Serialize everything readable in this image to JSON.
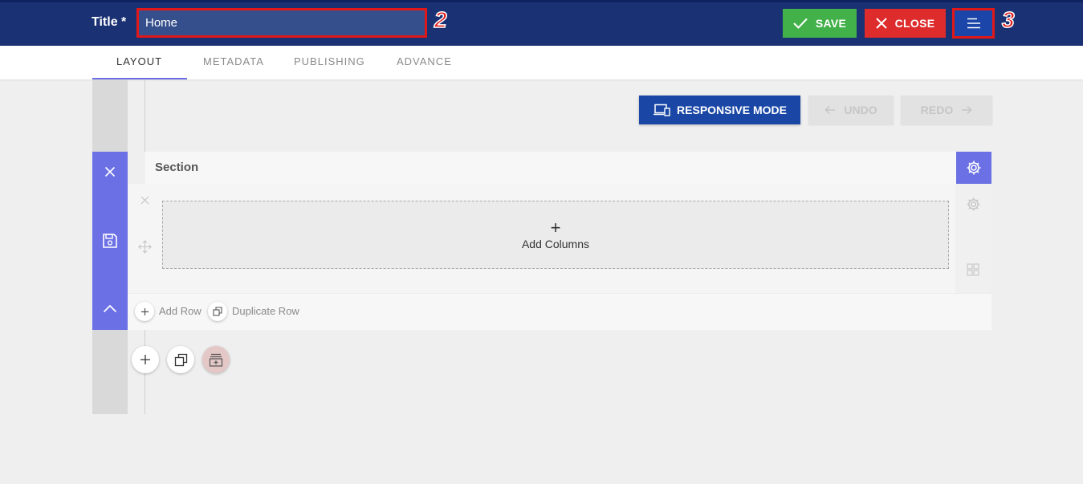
{
  "header": {
    "title_label": "Title *",
    "title_value": "Home",
    "save_label": "SAVE",
    "close_label": "CLOSE",
    "annotation_title": "2",
    "annotation_menu": "3",
    "colors": {
      "bar": "#1a3173",
      "save": "#43b14a",
      "close": "#de2b2b",
      "menu": "#1b45a8",
      "highlight": "#e01818"
    }
  },
  "tabs": [
    {
      "label": "LAYOUT",
      "active": true
    },
    {
      "label": "METADATA",
      "active": false
    },
    {
      "label": "PUBLISHING",
      "active": false
    },
    {
      "label": "ADVANCE",
      "active": false
    }
  ],
  "toolbar": {
    "responsive_label": "RESPONSIVE MODE",
    "undo_label": "UNDO",
    "redo_label": "REDO"
  },
  "section": {
    "title": "Section",
    "add_columns_label": "Add Columns",
    "add_row_label": "Add Row",
    "duplicate_row_label": "Duplicate Row"
  },
  "icons": [
    "close-icon",
    "save-disk-icon",
    "chevron-up-icon",
    "gear-icon",
    "move-icon",
    "grid-icon",
    "plus-icon",
    "duplicate-icon",
    "archive-add-icon",
    "devices-icon",
    "arrow-left-icon",
    "arrow-right-icon",
    "check-icon",
    "hamburger-menu-icon"
  ]
}
